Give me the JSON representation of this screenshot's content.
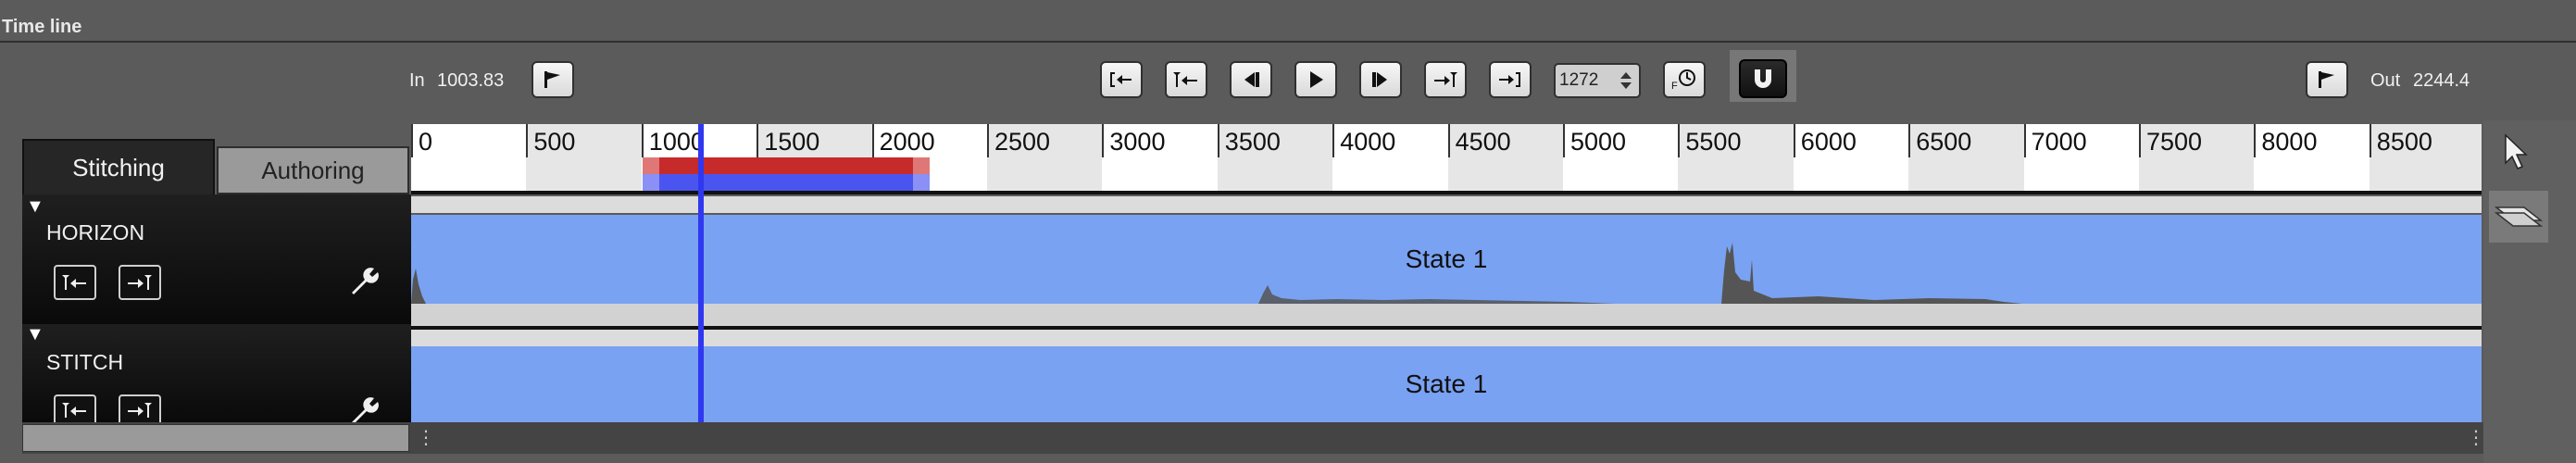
{
  "panel": {
    "title": "Time line"
  },
  "in_point": {
    "label": "In",
    "value": "1003.83"
  },
  "out_point": {
    "label": "Out",
    "value": "2244.4"
  },
  "frame": {
    "value": "1272"
  },
  "tabs": [
    {
      "label": "Stitching",
      "active": true
    },
    {
      "label": "Authoring",
      "active": false
    }
  ],
  "ruler": {
    "labels": [
      "0",
      "500",
      "1000",
      "1500",
      "2000",
      "2500",
      "3000",
      "3500",
      "4000",
      "4500",
      "5000",
      "5500",
      "6000",
      "6500",
      "7000",
      "7500",
      "8000",
      "8500"
    ]
  },
  "tracks": [
    {
      "name": "HORIZON",
      "state": "State 1"
    },
    {
      "name": "STITCH",
      "state": "State 1"
    }
  ],
  "icons": {
    "transport": [
      "jump-to-start-icon",
      "set-in-icon",
      "step-back-icon",
      "play-icon",
      "step-forward-icon",
      "set-out-icon",
      "jump-to-end-icon"
    ],
    "tools": [
      "pointer-tool-icon",
      "layers-tool-icon"
    ]
  },
  "colors": {
    "playhead": "#2f38f0",
    "state_fill": "#7aa2f2",
    "selection_red": "#c72a2a",
    "selection_blue": "#4a55f0"
  }
}
